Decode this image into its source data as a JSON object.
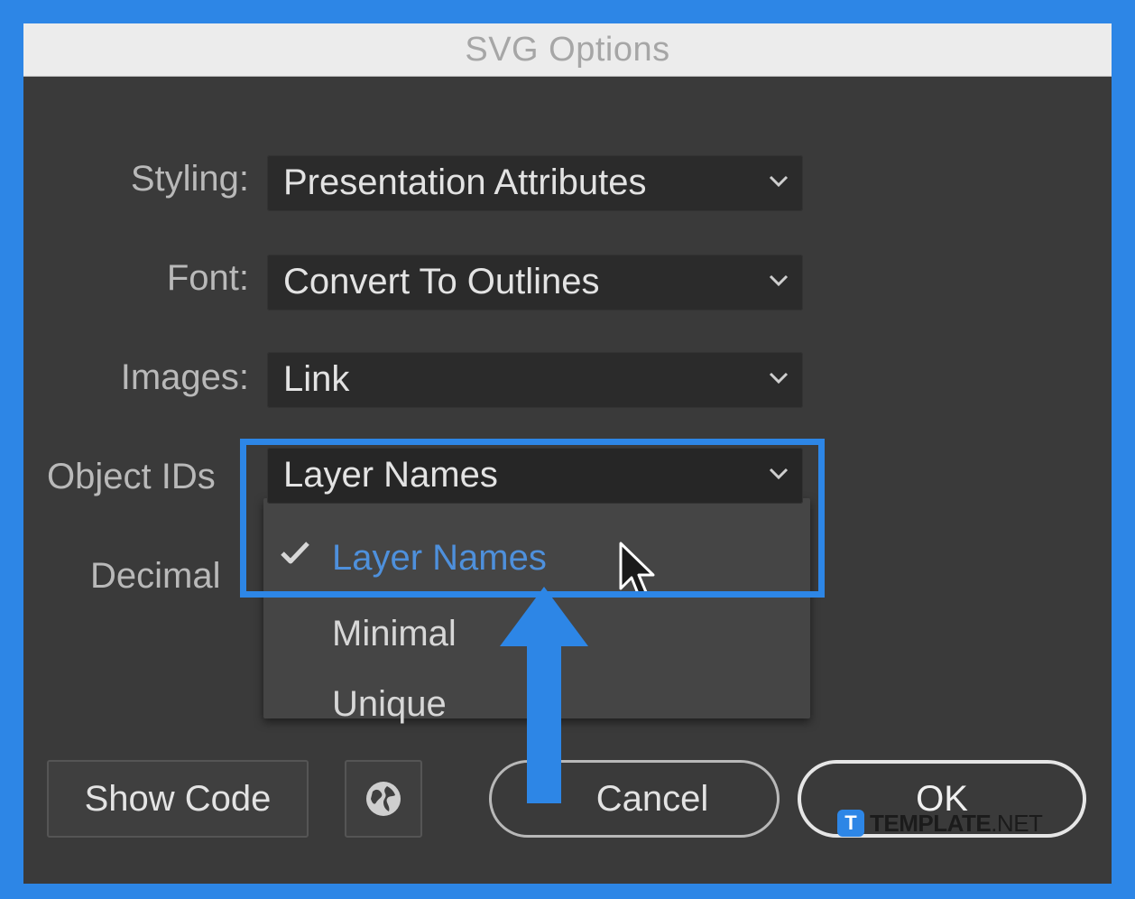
{
  "window": {
    "title": "SVG Options"
  },
  "fields": [
    {
      "label": "Styling:",
      "value": "Presentation Attributes"
    },
    {
      "label": "Font:",
      "value": "Convert To Outlines"
    },
    {
      "label": "Images:",
      "value": "Link"
    },
    {
      "label": "Object IDs",
      "value": "Layer Names"
    },
    {
      "label": "Decimal"
    }
  ],
  "object_ids_menu": {
    "options": [
      "Layer Names",
      "Minimal",
      "Unique"
    ],
    "selected": "Layer Names"
  },
  "buttons": {
    "show_code": "Show Code",
    "globe_icon": "globe-icon",
    "cancel": "Cancel",
    "ok": "OK"
  },
  "watermark": {
    "badge": "T",
    "brand": "TEMPLATE",
    "suffix": ".NET"
  },
  "colors": {
    "accent": "#2d86e6",
    "dialog_bg": "#3a3a3a",
    "selected_item": "#4e90dc"
  }
}
